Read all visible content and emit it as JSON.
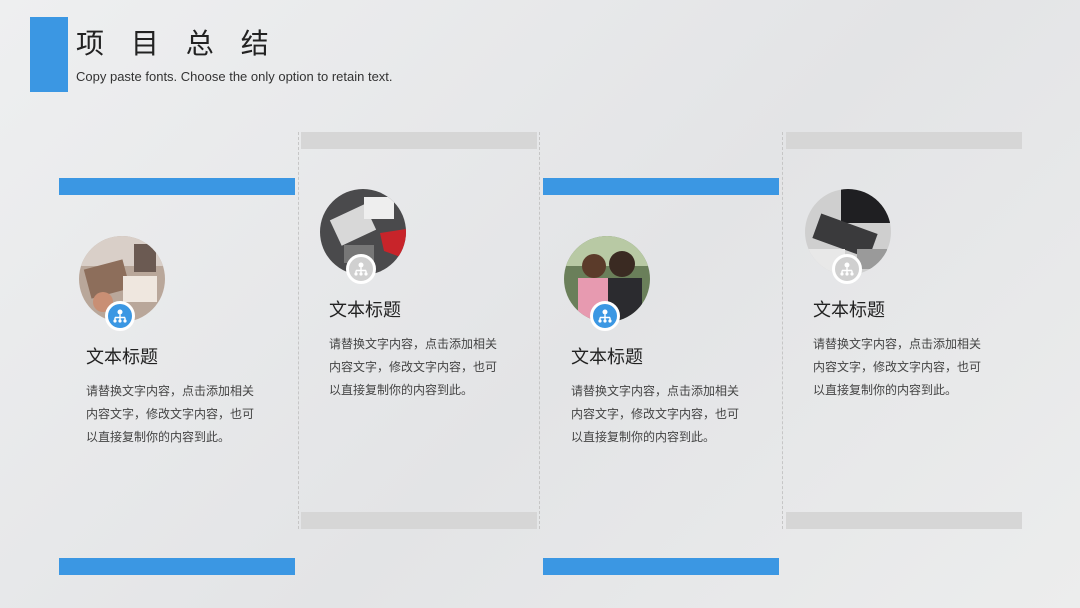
{
  "header": {
    "title": "项 目 总 结",
    "subtitle": "Copy paste fonts. Choose the only option to retain text."
  },
  "colors": {
    "accent": "#3b97e3",
    "muted": "#d6d6d6"
  },
  "cards": [
    {
      "title": "文本标题",
      "body": "请替换文字内容，点击添加相关内容文字，修改文字内容，也可以直接复制你的内容到此。",
      "icon": "network-icon",
      "photo": "desk-workspace-photo"
    },
    {
      "title": "文本标题",
      "body": "请替换文字内容，点击添加相关内容文字，修改文字内容，也可以直接复制你的内容到此。",
      "icon": "network-icon",
      "photo": "laptop-desk-photo"
    },
    {
      "title": "文本标题",
      "body": "请替换文字内容，点击添加相关内容文字，修改文字内容，也可以直接复制你的内容到此。",
      "icon": "network-icon",
      "photo": "two-women-photo"
    },
    {
      "title": "文本标题",
      "body": "请替换文字内容，点击添加相关内容文字，修改文字内容，也可以直接复制你的内容到此。",
      "icon": "network-icon",
      "photo": "keyboard-desk-photo"
    }
  ]
}
